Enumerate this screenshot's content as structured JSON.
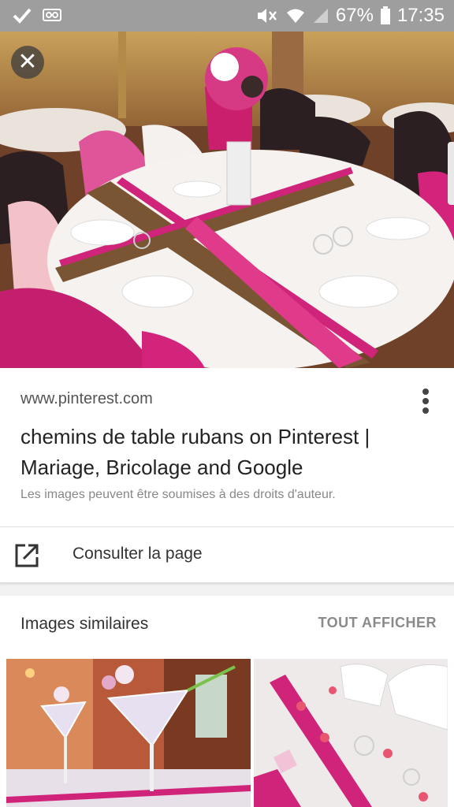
{
  "status_bar": {
    "battery": "67%",
    "time": "17:35"
  },
  "result": {
    "domain": "www.pinterest.com",
    "title": "chemins de table rubans on Pinterest | Mariage, Bricolage and Google",
    "copyright_note": "Les images peuvent être soumises à des droits d'auteur.",
    "visit_label": "Consulter la page"
  },
  "similar": {
    "heading": "Images similaires",
    "show_all": "TOUT AFFICHER"
  },
  "icons": {
    "check": "check-icon",
    "voicemail": "voicemail-icon",
    "mute": "mute-icon",
    "wifi": "wifi-icon",
    "signal": "signal-icon",
    "battery": "battery-icon",
    "close": "close-icon",
    "more": "more-vert-icon",
    "open": "open-in-new-icon"
  },
  "colors": {
    "accent_pink": "#d0247a",
    "status_bar": "#9e9e9e"
  }
}
